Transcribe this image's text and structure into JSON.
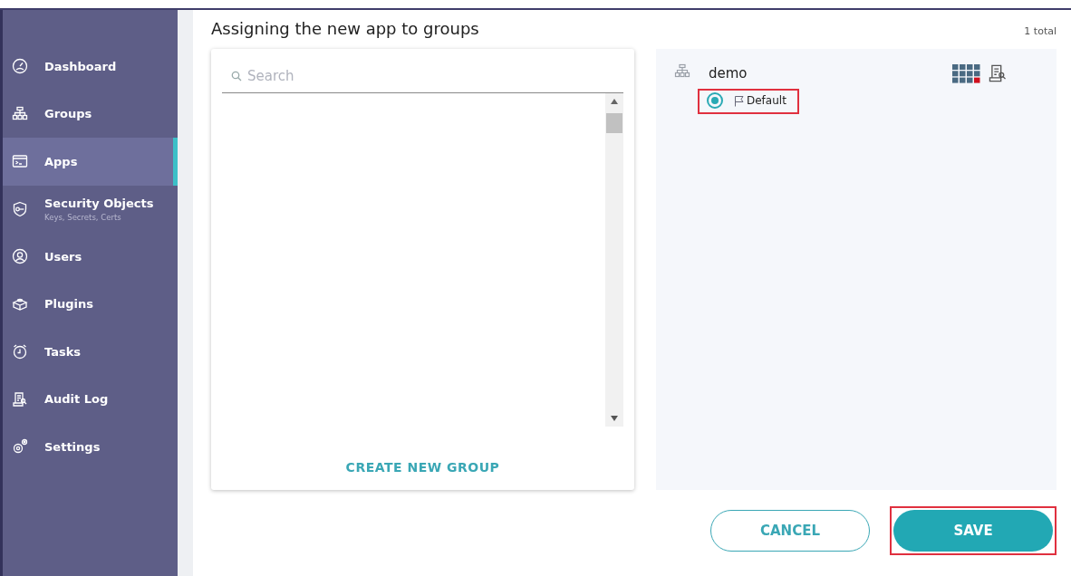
{
  "sidebar": {
    "items": [
      {
        "label": "Dashboard",
        "selected": false
      },
      {
        "label": "Groups",
        "selected": false
      },
      {
        "label": "Apps",
        "selected": true
      },
      {
        "label": "Security Objects",
        "sublabel": "Keys, Secrets, Certs",
        "selected": false
      },
      {
        "label": "Users",
        "selected": false
      },
      {
        "label": "Plugins",
        "selected": false
      },
      {
        "label": "Tasks",
        "selected": false
      },
      {
        "label": "Audit Log",
        "selected": false
      },
      {
        "label": "Settings",
        "selected": false
      }
    ]
  },
  "title": "Assigning the new app to groups",
  "total": "1 total",
  "search": {
    "placeholder": "Search"
  },
  "create_button": "CREATE NEW GROUP",
  "groups": [
    {
      "name": "demo",
      "options": [
        {
          "label": "Default",
          "selected": true,
          "highlighted": true
        }
      ]
    }
  ],
  "buttons": [
    {
      "label": "CANCEL",
      "kind": "outline",
      "highlighted": false
    },
    {
      "label": "SAVE",
      "kind": "primary",
      "highlighted": true
    }
  ]
}
